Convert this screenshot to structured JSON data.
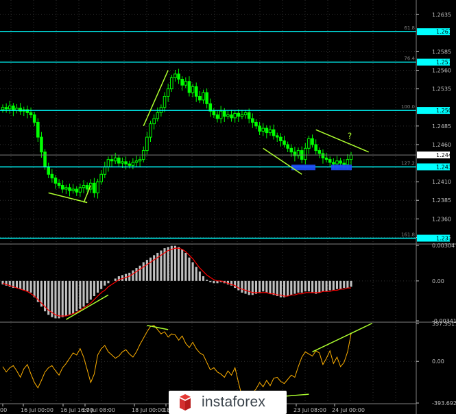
{
  "chart_data": {
    "type": "candlestick",
    "price_panel": {
      "y_ticks": [
        "1.2635",
        "1.2585",
        "1.2560",
        "1.2535",
        "1.2485",
        "1.2460",
        "1.2410",
        "1.2385",
        "1.2360",
        "1.2335"
      ],
      "ylim": [
        1.2328,
        1.265
      ],
      "current_price": "1.2446",
      "levels": [
        {
          "fib": "61.8",
          "value": "1.2612"
        },
        {
          "fib": "76.4",
          "value": "1.2571"
        },
        {
          "fib": "100.0",
          "value": "1.2506"
        },
        {
          "fib": "127.2",
          "value": "1.2430"
        },
        {
          "fib": "161.8",
          "value": "1.2334"
        }
      ],
      "annotation": "?",
      "closes": [
        1.251,
        1.2508,
        1.2512,
        1.2506,
        1.2509,
        1.2505,
        1.2507,
        1.2503,
        1.25,
        1.249,
        1.247,
        1.245,
        1.243,
        1.242,
        1.2415,
        1.2408,
        1.2405,
        1.24,
        1.2402,
        1.2398,
        1.24,
        1.2396,
        1.2402,
        1.2405,
        1.24,
        1.2408,
        1.2395,
        1.241,
        1.242,
        1.243,
        1.244,
        1.2438,
        1.2442,
        1.2435,
        1.2437,
        1.2434,
        1.2432,
        1.2436,
        1.2438,
        1.244,
        1.2452,
        1.247,
        1.2488,
        1.2495,
        1.2503,
        1.251,
        1.2525,
        1.2535,
        1.255,
        1.2555,
        1.2548,
        1.254,
        1.2545,
        1.253,
        1.2538,
        1.2525,
        1.252,
        1.253,
        1.2515,
        1.2505,
        1.25,
        1.2495,
        1.2505,
        1.2498,
        1.25,
        1.2496,
        1.2502,
        1.2498,
        1.25,
        1.2503,
        1.2495,
        1.249,
        1.2485,
        1.2478,
        1.2482,
        1.2476,
        1.248,
        1.2472,
        1.247,
        1.2465,
        1.246,
        1.2455,
        1.245,
        1.2445,
        1.2452,
        1.244,
        1.2455,
        1.2468,
        1.246,
        1.2452,
        1.2448,
        1.2442,
        1.244,
        1.2436,
        1.2434,
        1.2438,
        1.2435,
        1.2433,
        1.244,
        1.2446
      ]
    },
    "macd_panel": {
      "y_ticks": [
        "0.00304",
        "0.00",
        "-0.00341"
      ],
      "histogram": [
        -0.0003,
        -0.0004,
        -0.0005,
        -0.0006,
        -0.0006,
        -0.0007,
        -0.0008,
        -0.0009,
        -0.001,
        -0.0014,
        -0.0018,
        -0.0022,
        -0.0026,
        -0.0029,
        -0.0031,
        -0.0032,
        -0.0032,
        -0.0031,
        -0.003,
        -0.0029,
        -0.0028,
        -0.0026,
        -0.0024,
        -0.0022,
        -0.0019,
        -0.0016,
        -0.0013,
        -0.001,
        -0.0007,
        -0.0004,
        -0.0002,
        0.0,
        0.0002,
        0.0004,
        0.0005,
        0.0006,
        0.0007,
        0.0009,
        0.0011,
        0.0013,
        0.0016,
        0.0018,
        0.002,
        0.0022,
        0.0024,
        0.0026,
        0.0028,
        0.0029,
        0.003,
        0.003,
        0.0029,
        0.0027,
        0.0024,
        0.002,
        0.0016,
        0.0012,
        0.0008,
        0.0004,
        0.0001,
        -0.0001,
        -0.0002,
        -0.0002,
        -0.0001,
        -0.0002,
        -0.0003,
        -0.0004,
        -0.0006,
        -0.0008,
        -0.001,
        -0.0011,
        -0.0012,
        -0.0012,
        -0.0011,
        -0.001,
        -0.0009,
        -0.001,
        -0.0011,
        -0.0012,
        -0.0013,
        -0.0014,
        -0.0014,
        -0.0013,
        -0.0012,
        -0.0011,
        -0.001,
        -0.001,
        -0.0009,
        -0.0009,
        -0.001,
        -0.0011,
        -0.001,
        -0.0009,
        -0.0009,
        -0.0008,
        -0.0008,
        -0.0007,
        -0.0007,
        -0.0006,
        -0.0006,
        -0.0005
      ],
      "signal": [
        -0.0002,
        -0.0003,
        -0.0004,
        -0.0005,
        -0.0006,
        -0.0007,
        -0.0008,
        -0.0009,
        -0.0011,
        -0.0013,
        -0.0016,
        -0.0019,
        -0.0022,
        -0.0025,
        -0.0027,
        -0.0029,
        -0.003,
        -0.003,
        -0.003,
        -0.0029,
        -0.0028,
        -0.0027,
        -0.0025,
        -0.0023,
        -0.0021,
        -0.0019,
        -0.0016,
        -0.0013,
        -0.001,
        -0.0008,
        -0.0005,
        -0.0003,
        -0.0001,
        0.0001,
        0.0002,
        0.0003,
        0.0004,
        0.0006,
        0.0008,
        0.001,
        0.0012,
        0.0014,
        0.0016,
        0.0018,
        0.002,
        0.0022,
        0.0024,
        0.0026,
        0.0027,
        0.0028,
        0.0028,
        0.0027,
        0.0025,
        0.0022,
        0.0019,
        0.0015,
        0.0011,
        0.0008,
        0.0005,
        0.0003,
        0.0001,
        0.0,
        0.0,
        -0.0001,
        -0.0002,
        -0.0003,
        -0.0004,
        -0.0006,
        -0.0007,
        -0.0008,
        -0.0009,
        -0.001,
        -0.001,
        -0.001,
        -0.001,
        -0.001,
        -0.0011,
        -0.0011,
        -0.0012,
        -0.0012,
        -0.0013,
        -0.0013,
        -0.0012,
        -0.0012,
        -0.0011,
        -0.0011,
        -0.001,
        -0.001,
        -0.001,
        -0.001,
        -0.001,
        -0.0009,
        -0.0009,
        -0.0009,
        -0.0008,
        -0.0008,
        -0.0007,
        -0.0007,
        -0.0006,
        -0.0006
      ]
    },
    "osc_panel": {
      "y_ticks": [
        "357.5517",
        "0.00",
        "-393.692"
      ],
      "values": [
        -50,
        -100,
        -60,
        -40,
        -90,
        -150,
        -70,
        -30,
        -120,
        -200,
        -250,
        -180,
        -100,
        -60,
        -40,
        -90,
        -130,
        -60,
        -20,
        30,
        80,
        60,
        120,
        40,
        -80,
        -200,
        -120,
        60,
        120,
        150,
        90,
        60,
        30,
        50,
        90,
        110,
        70,
        40,
        90,
        160,
        220,
        280,
        330,
        340,
        300,
        260,
        280,
        230,
        260,
        250,
        200,
        240,
        170,
        130,
        180,
        120,
        80,
        60,
        -10,
        -80,
        -60,
        -100,
        -120,
        -150,
        -90,
        -130,
        -60,
        -200,
        -330,
        -360,
        -350,
        -300,
        -260,
        -200,
        -240,
        -180,
        -230,
        -160,
        -150,
        -190,
        -210,
        -170,
        -130,
        -150,
        -50,
        40,
        90,
        70,
        50,
        100,
        80,
        -30,
        30,
        100,
        -20,
        40,
        -50,
        -10,
        90,
        260
      ],
      "divergence_labels": []
    },
    "x_ticks": [
      "00",
      "16 Jul 00:00",
      "16 Jul 16:00",
      "17 Jul 08:00",
      "18 Jul 00:00",
      "18 Jul",
      "23 Jul 08:00",
      "24 Jul 00:00"
    ],
    "colors": {
      "up": "#00ff00",
      "down": "#00ff00",
      "level": "#00ffff",
      "trend": "#adff2f",
      "macd_hist": "#c0c0c0",
      "macd_signal": "#ff0000",
      "osc": "#ffb000",
      "support_zone": "#1f4fff",
      "grid": "#333333",
      "axis": "#c0c0c0"
    }
  },
  "watermark": {
    "text": "instaforex",
    "logo_icon": "instaforex-logo-icon"
  }
}
